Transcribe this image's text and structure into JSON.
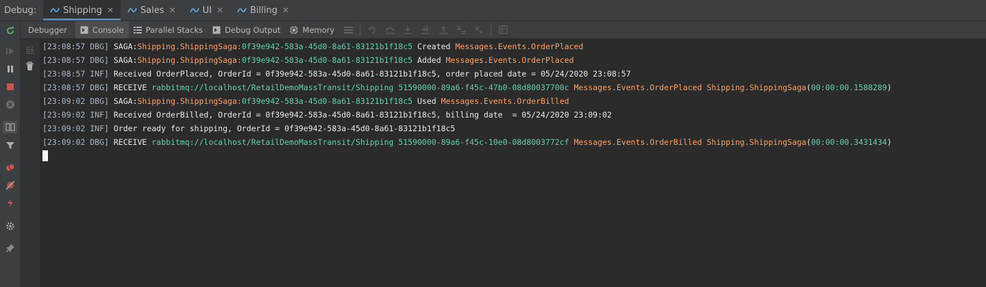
{
  "header": {
    "debug_label": "Debug:",
    "tabs": [
      {
        "label": "Shipping",
        "active": true
      },
      {
        "label": "Sales",
        "active": false
      },
      {
        "label": "UI",
        "active": false
      },
      {
        "label": "Billing",
        "active": false
      }
    ]
  },
  "toolbar": {
    "tabs": [
      {
        "label": "Debugger",
        "icon": "none"
      },
      {
        "label": "Console",
        "icon": "console-icon"
      },
      {
        "label": "Parallel Stacks",
        "icon": "parallel-stacks-icon"
      },
      {
        "label": "Debug Output",
        "icon": "debug-output-icon"
      },
      {
        "label": "Memory",
        "icon": "memory-icon"
      }
    ],
    "active_tab": "Console"
  },
  "colors": {
    "accent_tab": "#4a88c7",
    "orange": "#ffa060",
    "green": "#60d0b0",
    "rerun": "#59a869",
    "stop": "#c75450"
  },
  "console": {
    "lines": [
      {
        "ts": "[23:08:57 DBG]",
        "parts": [
          [
            "t",
            " SAGA:"
          ],
          [
            "o",
            "Shipping.ShippingSaga"
          ],
          [
            "g",
            ":0f39e942-583a-45d0-8a61-83121b1f18c5"
          ],
          [
            "t",
            " Created "
          ],
          [
            "o",
            "Messages.Events.OrderPlaced"
          ]
        ]
      },
      {
        "ts": "[23:08:57 DBG]",
        "parts": [
          [
            "t",
            " SAGA:"
          ],
          [
            "o",
            "Shipping.ShippingSaga"
          ],
          [
            "g",
            ":0f39e942-583a-45d0-8a61-83121b1f18c5"
          ],
          [
            "t",
            " Added "
          ],
          [
            "o",
            "Messages.Events.OrderPlaced"
          ]
        ]
      },
      {
        "ts": "[23:08:57 INF]",
        "parts": [
          [
            "t",
            " Received OrderPlaced, OrderId = 0f39e942-583a-45d0-8a61-83121b1f18c5, order placed date = 05/24/2020 23:08:57"
          ]
        ]
      },
      {
        "ts": "[23:08:57 DBG]",
        "parts": [
          [
            "t",
            " RECEIVE "
          ],
          [
            "g",
            "rabbitmq://localhost/RetailDemoMassTransit/Shipping 51590000-89a6-f45c-47b0-08d80037700c"
          ],
          [
            "t",
            " "
          ],
          [
            "o",
            "Messages.Events.OrderPlaced Shipping.ShippingSaga"
          ],
          [
            "t",
            "("
          ],
          [
            "g",
            "00:00:00.1588289"
          ],
          [
            "t",
            ")"
          ]
        ]
      },
      {
        "ts": "[23:09:02 DBG]",
        "parts": [
          [
            "t",
            " SAGA:"
          ],
          [
            "o",
            "Shipping.ShippingSaga"
          ],
          [
            "g",
            ":0f39e942-583a-45d0-8a61-83121b1f18c5"
          ],
          [
            "t",
            " Used "
          ],
          [
            "o",
            "Messages.Events.OrderBilled"
          ]
        ]
      },
      {
        "ts": "[23:09:02 INF]",
        "parts": [
          [
            "t",
            " Received OrderBilled, OrderId = 0f39e942-583a-45d0-8a61-83121b1f18c5, billing date  = 05/24/2020 23:09:02"
          ]
        ]
      },
      {
        "ts": "[23:09:02 INF]",
        "parts": [
          [
            "t",
            " Order ready for shipping, OrderId = 0f39e942-583a-45d0-8a61-83121b1f18c5"
          ]
        ]
      },
      {
        "ts": "[23:09:02 DBG]",
        "parts": [
          [
            "t",
            " RECEIVE "
          ],
          [
            "g",
            "rabbitmq://localhost/RetailDemoMassTransit/Shipping 51590000-89a6-f45c-10e0-08d8003772cf"
          ],
          [
            "t",
            " "
          ],
          [
            "o",
            "Messages.Events.OrderBilled Shipping.ShippingSaga"
          ],
          [
            "t",
            "("
          ],
          [
            "g",
            "00:00:00.3431434"
          ],
          [
            "t",
            ")"
          ]
        ]
      }
    ],
    "cursor_char": "ß"
  }
}
